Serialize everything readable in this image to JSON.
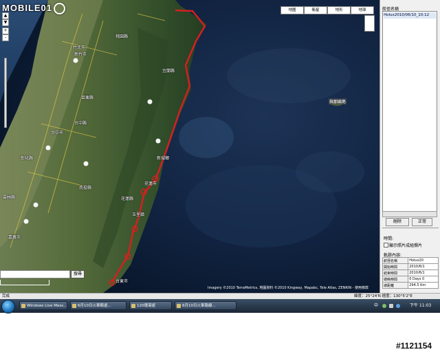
{
  "map": {
    "logo_text": "MOBILE01",
    "map_types": [
      "地圖",
      "衛星",
      "地形",
      "地球"
    ],
    "zoom_in": "+",
    "zoom_out": "-",
    "places": [
      "竹北市",
      "新竹市",
      "桃園縣",
      "苗栗縣",
      "台中縣",
      "台中市",
      "彰化縣",
      "南投縣",
      "雲林縣",
      "嘉義市",
      "宜蘭縣",
      "花蓮縣",
      "新城鄉",
      "花蓮市",
      "玉里鎮",
      "台東市"
    ],
    "island_label": "與那國島",
    "search_button": "搜尋",
    "copyright": "Imagery ©2010 TerraMetrics, 地圖資料 ©2010 Kingway, Mapabc, Tele Atlas, ZENRIN - 使用條款"
  },
  "panel": {
    "title": "航徑名稱",
    "track_name": "Holux2010/06/10_10:12",
    "button_delete": "刪除",
    "button_normal": "正常",
    "time_label": "時間:",
    "checkbox_label": "顯示照片成組擷片",
    "track_content_label": "軌跡內容:",
    "info_rows": [
      {
        "key": "航徑名稱",
        "value": "Holux20"
      },
      {
        "key": "開始時間",
        "value": "2010/6/1"
      },
      {
        "key": "結束時間",
        "value": "2010/6/1"
      },
      {
        "key": "總耗時間",
        "value": "0 Days 0"
      },
      {
        "key": "總距離",
        "value": "294.5 Km"
      }
    ]
  },
  "statusbar": {
    "left": "完成",
    "coords": "緯度：25°24'N  經度：130°5'2\"E"
  },
  "taskbar": {
    "tasks": [
      "Windows Live Mess...",
      "6月10日火車騎遊...",
      "120環港遊",
      "6月10日火車路線..."
    ],
    "tray_lang": "中",
    "clock": "下午 11:03"
  },
  "watermark": "#1121154",
  "colors": {
    "route": "#d42020",
    "ocean": "#0c1e3a",
    "land": "#4f6a3a"
  }
}
